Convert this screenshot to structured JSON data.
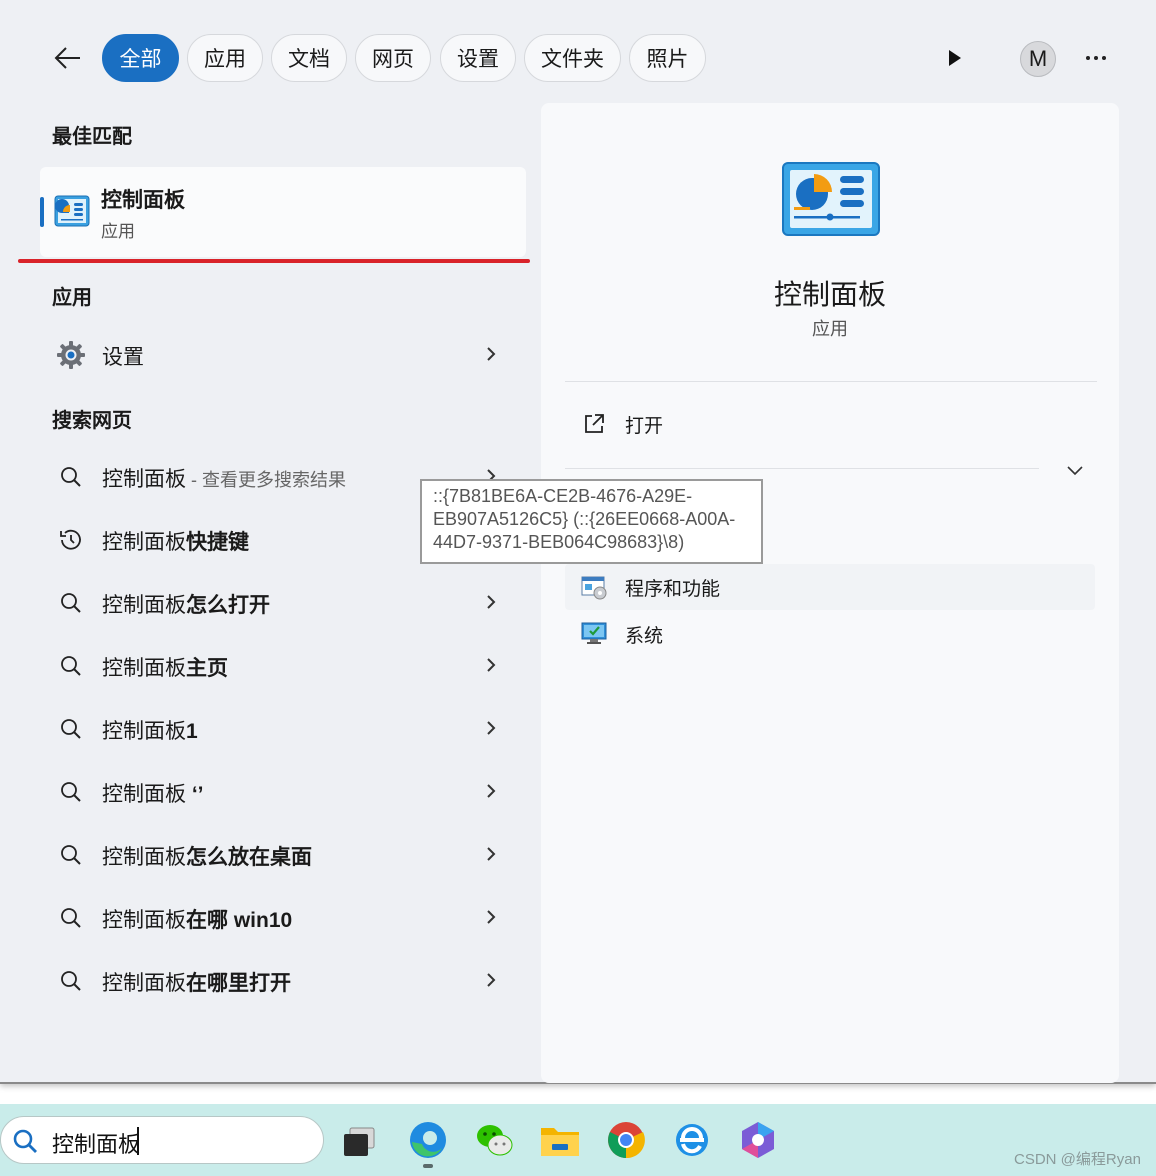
{
  "filters": {
    "items": [
      "全部",
      "应用",
      "文档",
      "网页",
      "设置",
      "文件夹",
      "照片"
    ],
    "active_index": 0,
    "avatar_initial": "M"
  },
  "best_match": {
    "section_title": "最佳匹配",
    "title": "控制面板",
    "subtitle": "应用",
    "icon": "control-panel-icon"
  },
  "apps": {
    "section_title": "应用",
    "items": [
      {
        "label": "设置",
        "icon": "settings-gear-icon"
      }
    ]
  },
  "web_search": {
    "section_title": "搜索网页",
    "items": [
      {
        "prefix": "控制面板",
        "bold": "",
        "muted": " - 查看更多搜索结果",
        "icon": "search-icon"
      },
      {
        "prefix": "控制面板",
        "bold": "快捷键",
        "muted": "",
        "icon": "history-icon"
      },
      {
        "prefix": "控制面板",
        "bold": "怎么打开",
        "muted": "",
        "icon": "search-icon"
      },
      {
        "prefix": "控制面板",
        "bold": "主页",
        "muted": "",
        "icon": "search-icon"
      },
      {
        "prefix": "控制面板",
        "bold": "1",
        "muted": "",
        "icon": "search-icon"
      },
      {
        "prefix": "控制面板",
        "bold": " ‘’",
        "muted": "",
        "icon": "search-icon"
      },
      {
        "prefix": "控制面板",
        "bold": "怎么放在桌面",
        "muted": "",
        "icon": "search-icon"
      },
      {
        "prefix": "控制面板",
        "bold": "在哪 win10",
        "muted": "",
        "icon": "search-icon"
      },
      {
        "prefix": "控制面板",
        "bold": "在哪里打开",
        "muted": "",
        "icon": "search-icon"
      }
    ]
  },
  "detail": {
    "title": "控制面板",
    "subtitle": "应用",
    "open_label": "打开",
    "recent": [
      {
        "label": "程序和功能",
        "icon": "programs-features-icon"
      },
      {
        "label": "系统",
        "icon": "system-monitor-icon"
      }
    ]
  },
  "tooltip": {
    "text": "::{7B81BE6A-CE2B-4676-A29E-EB907A5126C5} (::{26EE0668-A00A-44D7-9371-BEB064C98683}\\8)"
  },
  "taskbar": {
    "search_value": "控制面板",
    "apps": [
      "task-view-icon",
      "edge-icon",
      "wechat-icon",
      "file-explorer-icon",
      "chrome-icon",
      "ie-icon",
      "copilot-icon"
    ]
  },
  "watermark": "CSDN @编程Ryan",
  "colors": {
    "accent": "#1a6fc2",
    "highlight_underline": "#d9232a",
    "taskbar": "#c9ecea"
  }
}
